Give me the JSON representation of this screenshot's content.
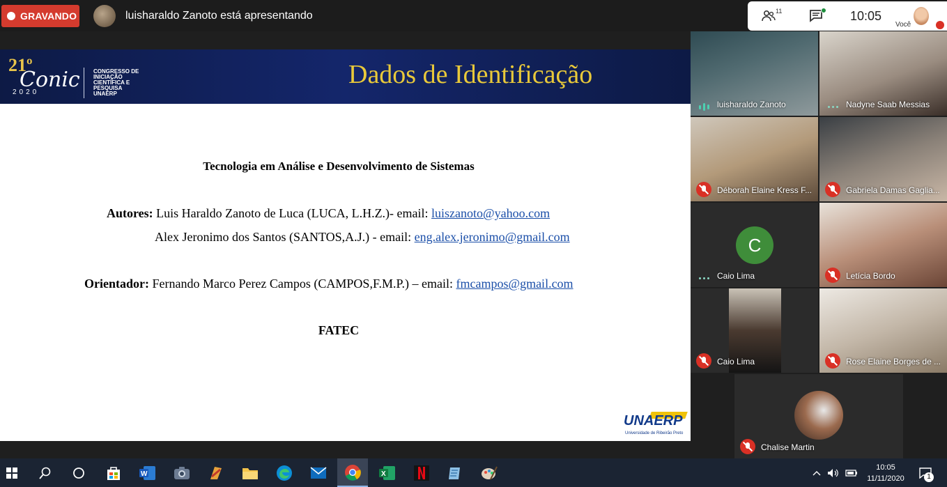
{
  "meeting": {
    "recording_label": "GRAVANDO",
    "presenting_text": "luisharaldo Zanoto está apresentando",
    "people_count": "11",
    "clock": "10:05",
    "self_label": "Você"
  },
  "slide": {
    "title": "Dados de Identificação",
    "logo": {
      "number": "21º",
      "word": "Conic",
      "year": "2020",
      "tagline": "Congresso de Iniciação Científica e Pesquisa UNAERP"
    },
    "course": "Tecnologia em Análise e Desenvolvimento de Sistemas",
    "authors_label": "Autores:",
    "author1": {
      "text": "Luis Haraldo Zanoto de Luca  (LUCA, L.H.Z.)- email:",
      "email": "luiszanoto@yahoo.com"
    },
    "author2": {
      "text": "Alex Jeronimo dos Santos  (SANTOS,A.J.) - email:",
      "email": "eng.alex.jeronimo@gmail.com"
    },
    "advisor_label": "Orientador:",
    "advisor": {
      "text": "Fernando Marco Perez Campos (CAMPOS,F.M.P.) – email:",
      "email": "fmcampos@gmail.com"
    },
    "institution": "FATEC",
    "brand": {
      "name": "UNAERP",
      "sub": "Universidade de Ribeirão Preto"
    }
  },
  "participants": [
    {
      "name": "luisharaldo Zanoto",
      "state": "speaking"
    },
    {
      "name": "Nadyne Saab Messias",
      "state": "unmuted"
    },
    {
      "name": "Déborah Elaine Kress F...",
      "state": "muted"
    },
    {
      "name": "Gabriela Damas Gaglia...",
      "state": "muted"
    },
    {
      "name": "Caio Lima",
      "state": "unmuted",
      "initial": "C"
    },
    {
      "name": "Letícia Bordo",
      "state": "muted"
    },
    {
      "name": "Caio Lima",
      "state": "muted"
    },
    {
      "name": "Rose Elaine Borges de ...",
      "state": "muted"
    },
    {
      "name": "Chalise Martin",
      "state": "muted"
    }
  ],
  "taskbar": {
    "apps": [
      "windows-start-icon",
      "search-icon",
      "task-view-icon",
      "store-icon",
      "word-icon",
      "camera-icon",
      "paint-icon",
      "file-explorer-icon",
      "edge-icon",
      "mail-icon",
      "chrome-icon",
      "excel-icon",
      "netflix-icon",
      "notepad-icon",
      "paint-3d-icon"
    ],
    "time": "10:05",
    "date": "11/11/2020",
    "notifications": "1"
  },
  "colors": {
    "recording": "#d43b2e",
    "muted": "#d93025",
    "slide_header": "#14266b",
    "slide_title": "#e9c93a",
    "link": "#1a4ea8"
  }
}
